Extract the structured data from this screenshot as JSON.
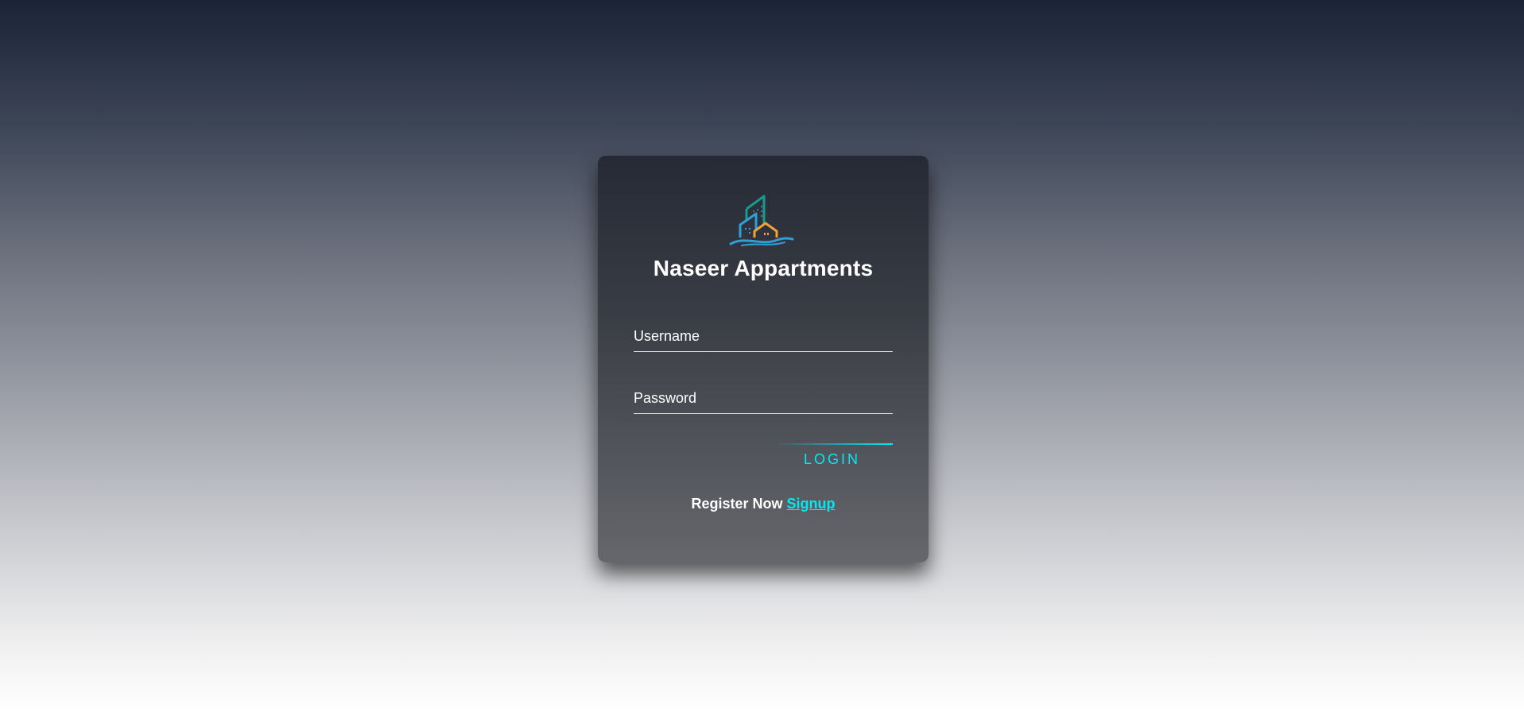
{
  "brand": {
    "name": "Naseer Appartments",
    "logo_icon": "building-house-logo-icon"
  },
  "form": {
    "username_placeholder": "Username",
    "password_placeholder": "Password",
    "login_label": "LOGIN"
  },
  "register": {
    "prompt": "Register Now",
    "link_label": "Signup"
  },
  "colors": {
    "accent": "#03e9f4",
    "logo_teal": "#1a9a8f",
    "logo_blue": "#2f9fd6",
    "logo_orange": "#f2a23a"
  }
}
